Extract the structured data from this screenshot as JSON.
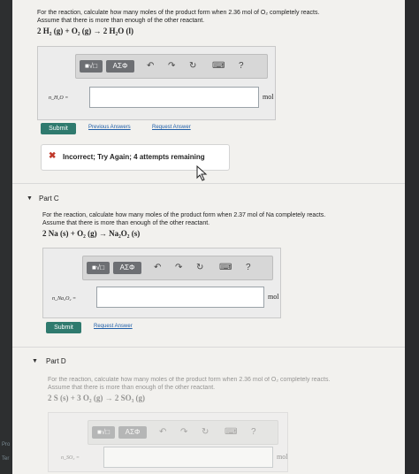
{
  "part_b": {
    "question_line1": "For the reaction, calculate how many moles of the product form when 2.36 mol of O₂ completely reacts.",
    "question_line2": "Assume that there is more than enough of the other reactant.",
    "equation": "2 H₂ (g) + O₂ (g) → 2 H₂O (l)",
    "toolbar": {
      "sqrt": "■√□",
      "greek": "AΣΦ",
      "undo": "↶",
      "redo": "↷",
      "reset": "↻",
      "keyboard": "⌨",
      "help": "?"
    },
    "var_label": "n_H₂O =",
    "input_value": "",
    "unit": "mol",
    "submit": "Submit",
    "previous_answers": "Previous Answers",
    "request_answer": "Request Answer",
    "feedback": "Incorrect; Try Again; 4 attempts remaining"
  },
  "part_c": {
    "title": "Part C",
    "question_line1": "For the reaction, calculate how many moles of the product form when 2.37 mol of Na completely reacts.",
    "question_line2": "Assume that there is more than enough of the other reactant.",
    "equation": "2 Na (s) + O₂ (g) → Na₂O₂ (s)",
    "toolbar": {
      "sqrt": "■√□",
      "greek": "AΣΦ",
      "undo": "↶",
      "redo": "↷",
      "reset": "↻",
      "keyboard": "⌨",
      "help": "?"
    },
    "var_label": "n_Na₂O₂ =",
    "input_value": "",
    "unit": "mol",
    "submit": "Submit",
    "request_answer": "Request Answer"
  },
  "part_d": {
    "title": "Part D",
    "question_line1": "For the reaction, calculate how many moles of the product form when 2.36 mol of O₂ completely reacts.",
    "question_line2": "Assume that there is more than enough of the other reactant.",
    "equation": "2 S (s) + 3 O₂ (g) → 2 SO₃ (g)",
    "toolbar": {
      "sqrt": "■√□",
      "greek": "AΣΦ",
      "undo": "↶",
      "redo": "↷",
      "reset": "↻",
      "keyboard": "⌨",
      "help": "?"
    },
    "var_label": "n_SO₃ =",
    "input_value": "",
    "unit": "mol"
  },
  "left_edge": {
    "line1": "Pro",
    "line2": "Ter"
  },
  "colors": {
    "submit": "#2f7a6e",
    "link": "#1f5ea8",
    "error": "#c0392b"
  }
}
